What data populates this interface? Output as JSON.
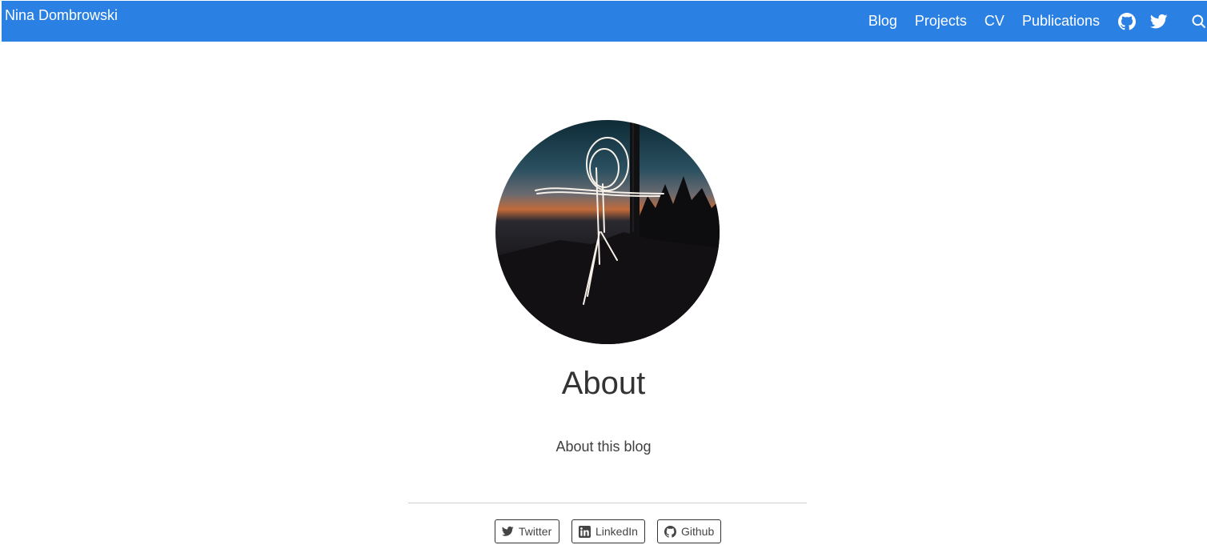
{
  "navbar": {
    "brand": "Nina Dombrowski",
    "background": "#2a80e3",
    "links": [
      {
        "label": "Blog"
      },
      {
        "label": "Projects"
      },
      {
        "label": "CV"
      },
      {
        "label": "Publications"
      }
    ],
    "icons": [
      "github-icon",
      "twitter-icon",
      "search-icon"
    ]
  },
  "main": {
    "avatar": "profile-photo-light-painting-figure",
    "title": "About",
    "subtitle": "About this blog"
  },
  "footer": {
    "social_buttons": [
      {
        "label": "Twitter",
        "icon": "twitter-icon"
      },
      {
        "label": "LinkedIn",
        "icon": "linkedin-icon"
      },
      {
        "label": "Github",
        "icon": "github-icon"
      }
    ]
  }
}
